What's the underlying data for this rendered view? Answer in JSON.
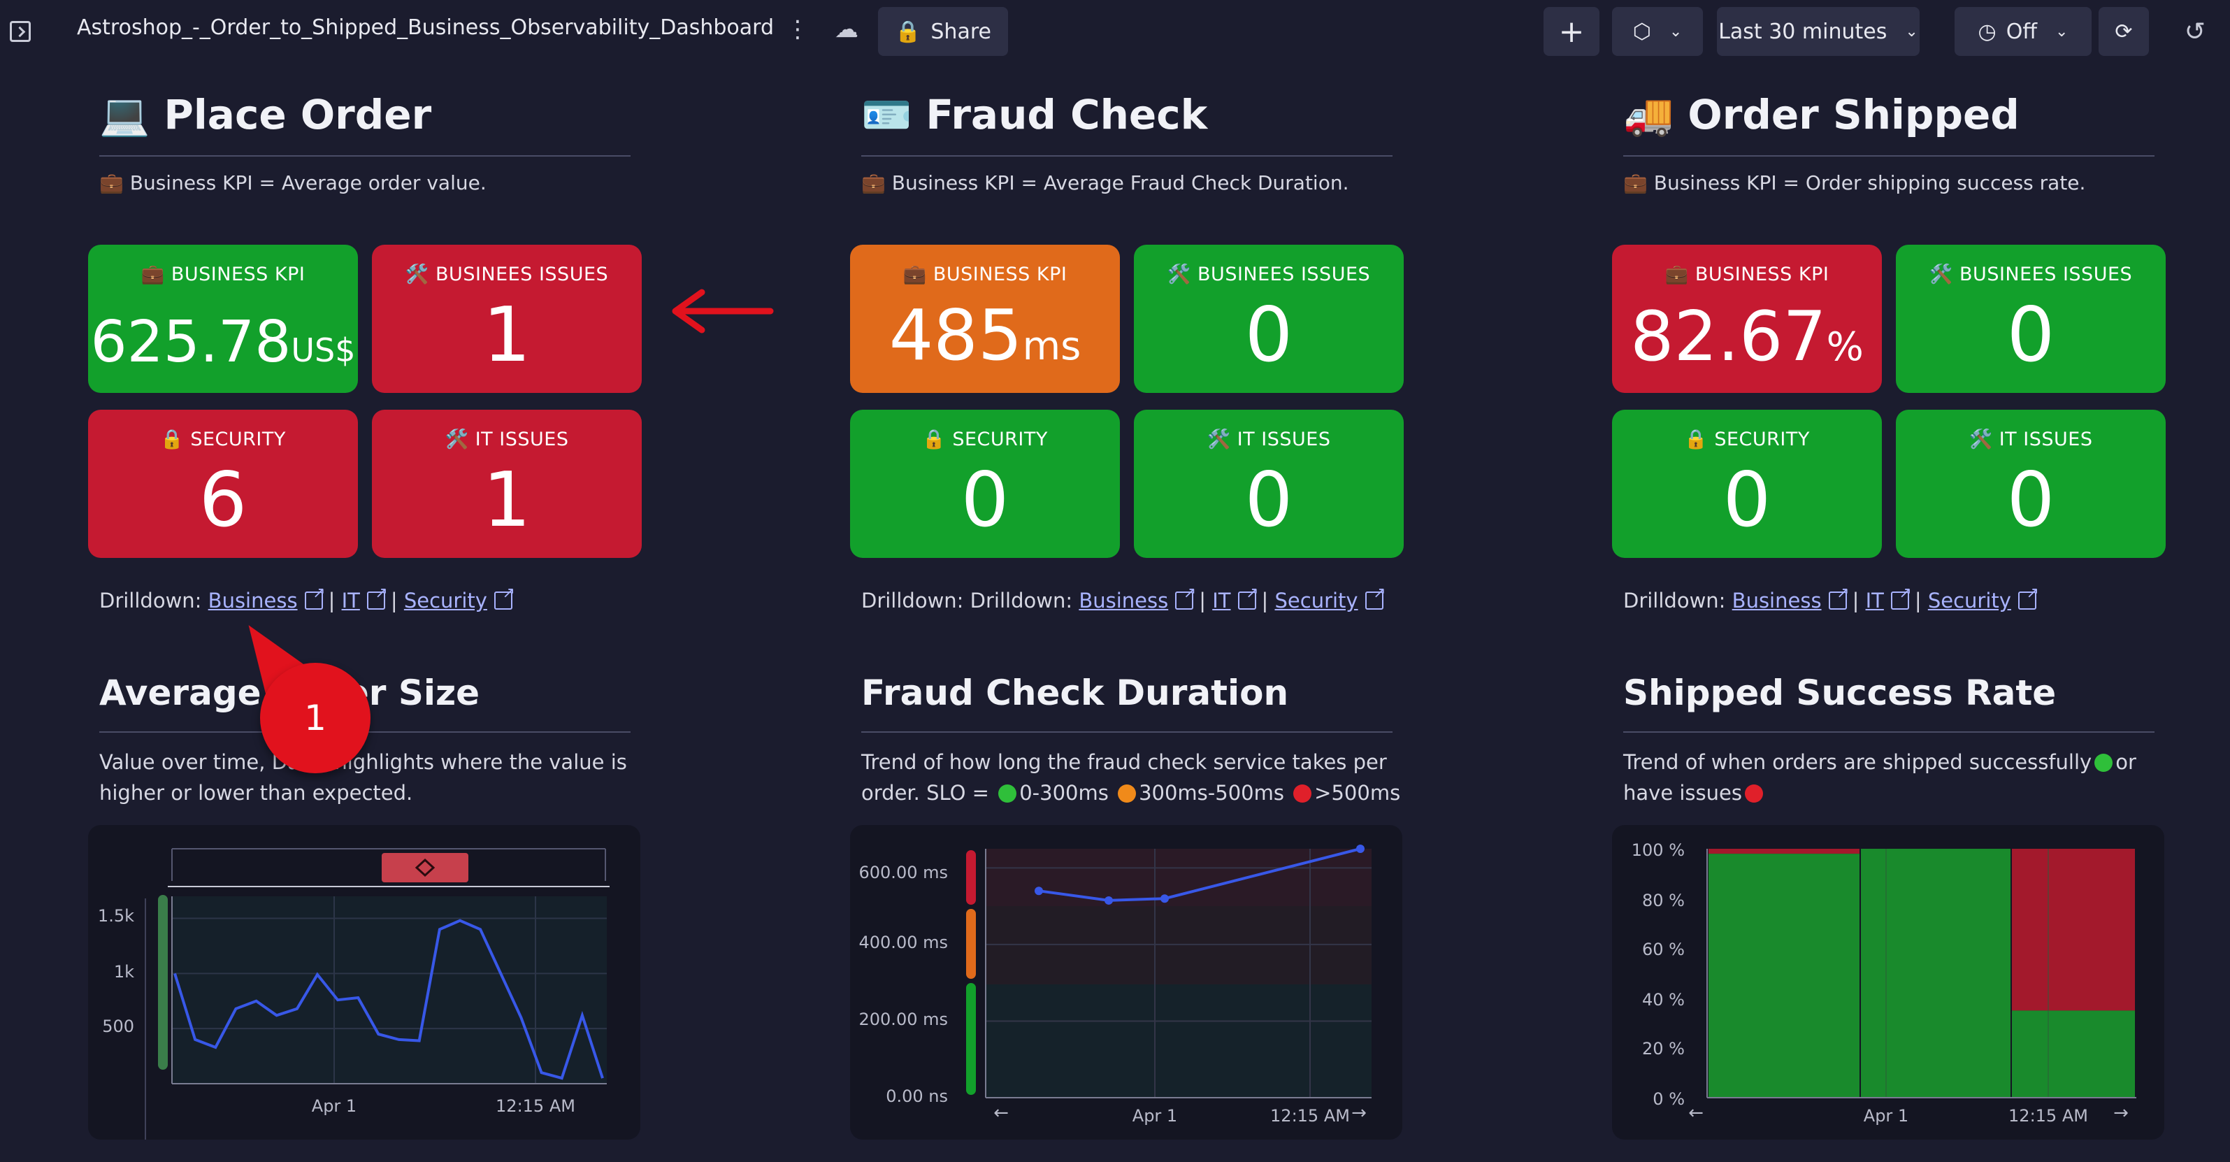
{
  "header": {
    "title": "Astroshop_-_Order_to_Shipped_Business_Observability_Dashboard",
    "share_label": "Share",
    "timeframe_label": "Last 30 minutes",
    "refresh_label": "Off"
  },
  "columns": [
    {
      "emoji": "💻",
      "title": "Place Order",
      "kpi_desc": "💼 Business KPI = Average order value.",
      "tiles": {
        "kpi": {
          "label": "💼 BUSINESS KPI",
          "value": "625.78",
          "unit": "US$",
          "color": "green"
        },
        "issues": {
          "label": "🛠️ BUSINEES ISSUES",
          "value": "1",
          "color": "red"
        },
        "security": {
          "label": "🔒 SECURITY",
          "value": "6",
          "color": "red"
        },
        "it": {
          "label": "🛠️ IT ISSUES",
          "value": "1",
          "color": "red"
        }
      },
      "drill_prefix": "Drilldown: ",
      "links": {
        "business": "Business",
        "it": "IT",
        "security": "Security"
      },
      "section_title": "Average Order Size",
      "section_desc": "Value over time, Davis highlights where the value is higher or lower than expected."
    },
    {
      "emoji": "🪪",
      "title": "Fraud Check",
      "kpi_desc": "💼 Business KPI = Average Fraud Check Duration.",
      "tiles": {
        "kpi": {
          "label": "💼 BUSINESS KPI",
          "value": "485",
          "unit": "ms",
          "color": "orange"
        },
        "issues": {
          "label": "🛠️ BUSINEES ISSUES",
          "value": "0",
          "color": "green"
        },
        "security": {
          "label": "🔒 SECURITY",
          "value": "0",
          "color": "green"
        },
        "it": {
          "label": "🛠️ IT ISSUES",
          "value": "0",
          "color": "green"
        }
      },
      "drill_prefix": "Drilldown: Drilldown: ",
      "links": {
        "business": "Business",
        "it": "IT",
        "security": "Security"
      },
      "section_title": "Fraud Check Duration",
      "section_desc_1": "Trend of how long the fraud check service takes per order. SLO = ",
      "slo_green": "0-300ms",
      "slo_orange": "300ms-500ms",
      "slo_red": ">500ms"
    },
    {
      "emoji": "🚚",
      "title": "Order Shipped",
      "kpi_desc": "💼 Business KPI = Order shipping success rate.",
      "tiles": {
        "kpi": {
          "label": "💼 BUSINESS KPI",
          "value": "82.67",
          "unit": "%",
          "color": "red"
        },
        "issues": {
          "label": "🛠️ BUSINEES ISSUES",
          "value": "0",
          "color": "green"
        },
        "security": {
          "label": "🔒 SECURITY",
          "value": "0",
          "color": "green"
        },
        "it": {
          "label": "🛠️ IT ISSUES",
          "value": "0",
          "color": "green"
        }
      },
      "drill_prefix": "Drilldown: ",
      "links": {
        "business": "Business",
        "it": "IT",
        "security": "Security"
      },
      "section_title": "Shipped Success Rate",
      "section_desc_1": "Trend of when orders are shipped successfully",
      "section_desc_2": "or",
      "section_desc_3": "have issues"
    }
  ],
  "annotation": {
    "badge": "1"
  },
  "chart_data": [
    {
      "type": "line",
      "ylim": [
        0,
        1700
      ],
      "yticks": [
        "1.5k",
        "1k",
        "500"
      ],
      "xticks": [
        "Apr 1",
        "12:15 AM"
      ],
      "series": [
        {
          "values": [
            1000,
            400,
            330,
            680,
            750,
            620,
            680,
            990,
            760,
            780,
            450,
            400,
            390,
            1400,
            1480,
            1400,
            1000,
            600,
            100,
            50,
            620,
            50
          ]
        }
      ],
      "color": "#3858e8"
    },
    {
      "type": "line",
      "ylim": [
        0,
        650
      ],
      "yticks": [
        "600.00 ms",
        "400.00 ms",
        "200.00 ms",
        "0.00 ns"
      ],
      "xticks": [
        "Apr 1",
        "12:15 AM"
      ],
      "series": [
        {
          "values": [
            540,
            515,
            520,
            650
          ]
        }
      ],
      "color": "#3858e8"
    },
    {
      "type": "area",
      "ylim": [
        0,
        100
      ],
      "yticks": [
        "100 %",
        "80 %",
        "60 %",
        "40 %",
        "20 %",
        "0 %"
      ],
      "xticks": [
        "Apr 1",
        "12:15 AM"
      ],
      "series": [
        {
          "values": [
            98,
            100,
            35
          ]
        }
      ],
      "colors": {
        "success": "#12a02b",
        "issue": "#c51a31"
      }
    }
  ]
}
